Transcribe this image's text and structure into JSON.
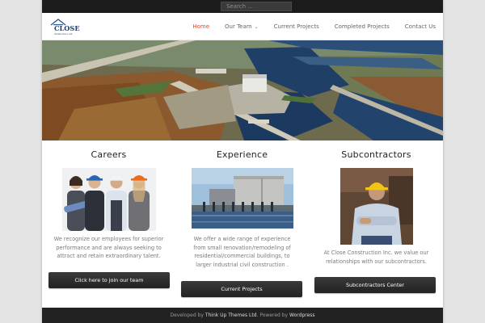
{
  "search": {
    "placeholder": "Search ..."
  },
  "logo": {
    "name": "CLOSE",
    "sub": "Construction, Ltd."
  },
  "nav": {
    "items": [
      {
        "label": "Home"
      },
      {
        "label": "Our Team"
      },
      {
        "label": "Current Projects"
      },
      {
        "label": "Completed Projects"
      },
      {
        "label": "Contact Us"
      }
    ],
    "active_color": "#e0462a"
  },
  "sections": [
    {
      "title": "Careers",
      "text": "We recognize our employees for superior performance and are always seeking to attract and retain extraordinary talent.",
      "button": "Click here to join our team"
    },
    {
      "title": "Experience",
      "text": "We offer a wide range of experience from small renovation/remodeling of residential/commercial buildings, to larger industrial civil construction .",
      "button": "Current Projects"
    },
    {
      "title": "Subcontractors",
      "text": "At Close Construction Inc. we value our relationships with our subcontractors.",
      "button": "Subcontractors Center"
    }
  ],
  "footer": {
    "prefix": "Developed by ",
    "developer": "Think Up Themes Ltd",
    "middle": ". Powered by ",
    "platform": "Wordpress"
  }
}
